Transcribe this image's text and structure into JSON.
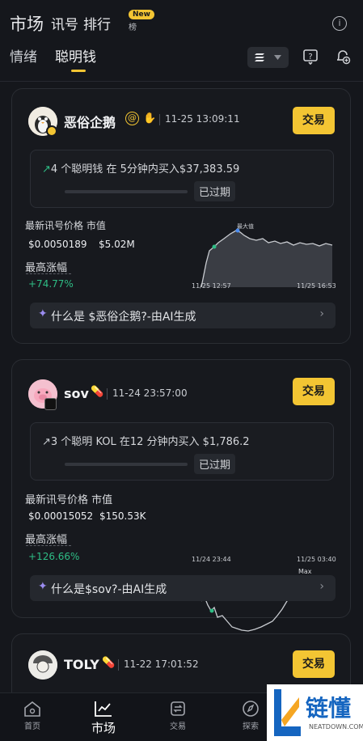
{
  "header": {
    "title": "市场",
    "tabs": [
      "讯号",
      "排行"
    ],
    "new_badge": "New",
    "new_sub": "榜",
    "sub_tabs": [
      "情绪",
      "聪明钱"
    ]
  },
  "cards": [
    {
      "name": "恶俗企鹅",
      "time": "11-25 13:09:11",
      "trade_label": "交易",
      "signal_arrow": "↗",
      "signal_text": "4 个聪明钱 在 5分钟内买入$37,383.59",
      "expired": "已过期",
      "price_label": "最新讯号价格 市值",
      "price": "$0.0050189",
      "mcap": "$5.02M",
      "gain_label": "最高涨幅",
      "gain": "+74.77%",
      "chart_start": "11/25 12:57",
      "chart_end": "11/25 16:53",
      "chart_peak": "最大值",
      "ai_text": "什么是 $恶俗企鹅?-由AI生成"
    },
    {
      "name": "sov",
      "time": "11-24 23:57:00",
      "trade_label": "交易",
      "signal_arrow": "↗",
      "signal_text": "3 个聪明 KOL 在12 分钟内买入 $1,786.2",
      "expired": "已过期",
      "price_label": "最新讯号价格 市值",
      "price": "$0.00015052",
      "mcap": "$150.53K",
      "gain_label": "最高涨幅",
      "gain": "+126.66%",
      "chart_start": "11/24 23:44",
      "chart_end": "11/25 03:40",
      "chart_peak": "Max",
      "ai_text": "什么是$sov?-由AI生成"
    },
    {
      "name": "TOLY",
      "time": "11-22 17:01:52",
      "trade_label": "交易"
    }
  ],
  "nav": [
    "首页",
    "市场",
    "交易",
    "探索"
  ],
  "watermark": {
    "brand": "链懂",
    "url": "NEATDOWN.COM"
  },
  "colors": {
    "accent": "#f3c533",
    "up": "#2ebd85",
    "bg": "#15171c"
  }
}
